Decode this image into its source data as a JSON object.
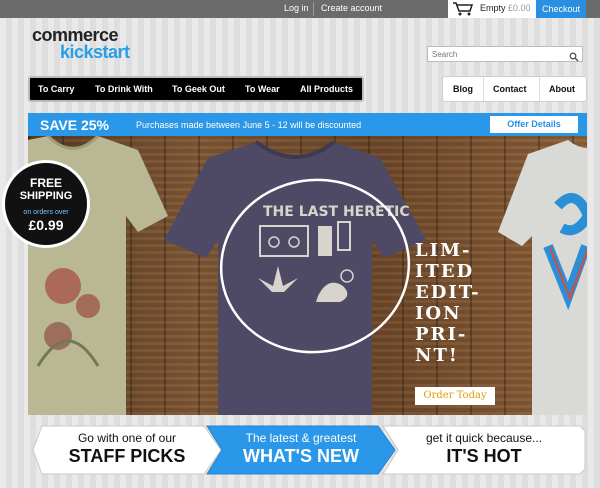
{
  "topbar": {
    "login": "Log in",
    "create_account": "Create account",
    "cart_status": "Empty",
    "cart_amount": "£0.00",
    "checkout": "Checkout"
  },
  "logo": {
    "line1": "commerce",
    "line2": "kickstart"
  },
  "search": {
    "placeholder": "Search"
  },
  "nav": {
    "main": [
      "To Carry",
      "To Drink With",
      "To Geek Out",
      "To Wear",
      "All Products"
    ],
    "secondary": [
      "Blog",
      "Contact",
      "About"
    ]
  },
  "promo": {
    "title": "SAVE 25%",
    "text": "Purchases made between June 5 - 12 will be discounted",
    "button": "Offer Details"
  },
  "hero": {
    "shirt_text": "THE LAST HERETIC",
    "badge": {
      "line1": "FREE",
      "line2": "SHIPPING",
      "line3": "on orders over",
      "line4": "£0.99"
    },
    "limited_text": "LIM-\nITED\nEDIT-\nION\nPRI-\nNT!",
    "order_button": "Order Today"
  },
  "tabs": [
    {
      "line1": "Go with one of our",
      "line2": "STAFF PICKS"
    },
    {
      "line1": "The latest & greatest",
      "line2": "WHAT'S NEW"
    },
    {
      "line1": "get it quick because...",
      "line2": "IT'S HOT"
    }
  ],
  "colors": {
    "accent": "#2a97e8",
    "topbar": "#6b6b6b",
    "nav": "#000000",
    "order_text": "#e0a000"
  }
}
